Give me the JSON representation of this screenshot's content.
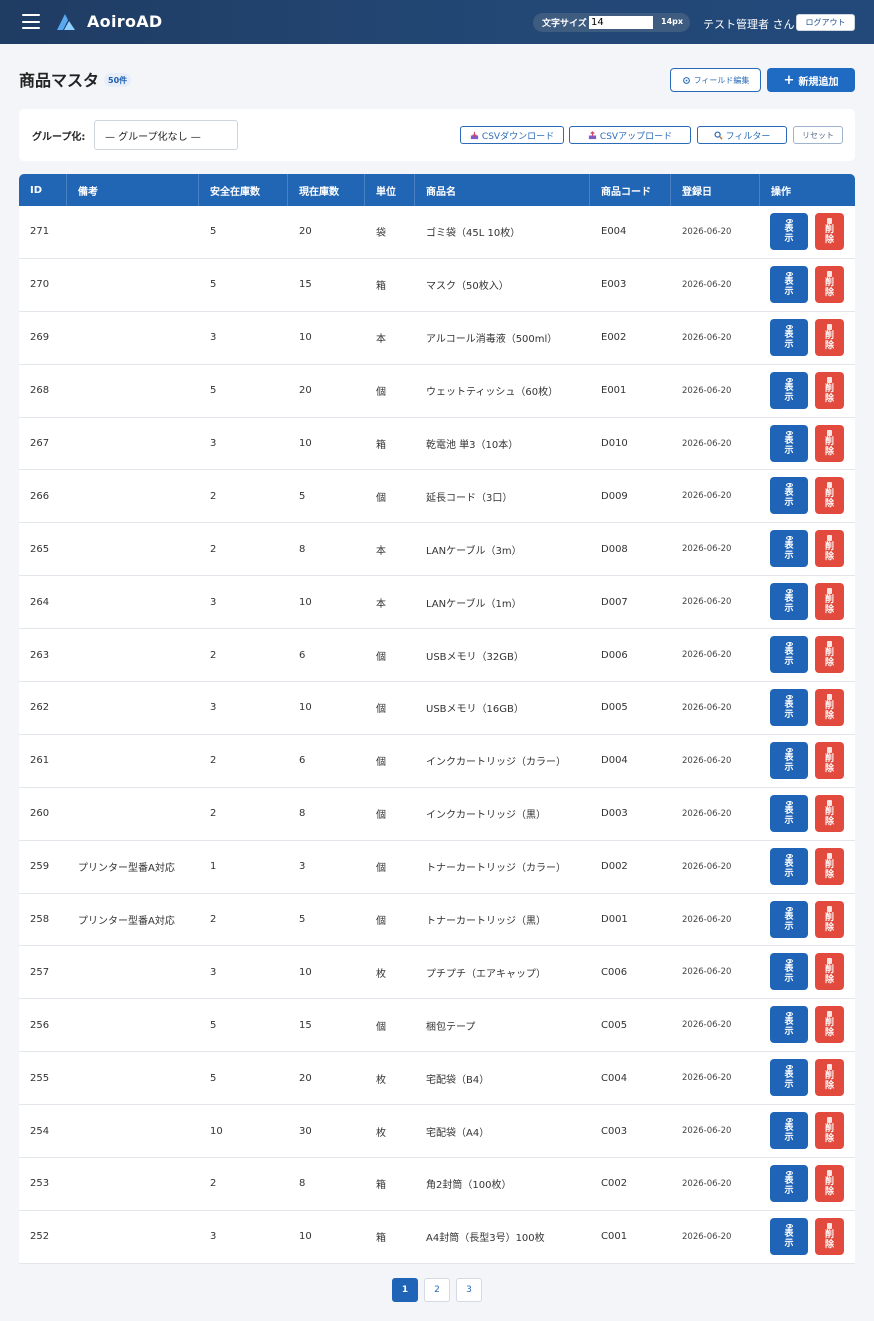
{
  "header": {
    "brand": "AoiroAD",
    "font_size_label": "文字サイズ",
    "font_size_value": "14",
    "font_size_unit": "14px",
    "user": "テスト管理者 さん",
    "logout": "ログアウト"
  },
  "page": {
    "title": "商品マスタ",
    "count": "50件",
    "field_edit": "フィールド編集",
    "add_new": "新規追加"
  },
  "toolbar": {
    "group_label": "グループ化:",
    "group_value": "— グループ化なし —",
    "csv_download": "CSVダウンロード",
    "csv_upload": "CSVアップロード",
    "filter": "フィルター",
    "reset": "リセット"
  },
  "table": {
    "columns": [
      "ID",
      "備考",
      "安全在庫数",
      "現在庫数",
      "単位",
      "商品名",
      "商品コード",
      "登録日",
      "操作"
    ],
    "view_label_1": "表",
    "view_label_2": "示",
    "delete_label_1": "削",
    "delete_label_2": "除",
    "rows": [
      {
        "id": "271",
        "note": "",
        "safety": "5",
        "stock": "20",
        "unit": "袋",
        "name": "ゴミ袋（45L 10枚）",
        "code": "E004",
        "date": "2026-06-20"
      },
      {
        "id": "270",
        "note": "",
        "safety": "5",
        "stock": "15",
        "unit": "箱",
        "name": "マスク（50枚入）",
        "code": "E003",
        "date": "2026-06-20"
      },
      {
        "id": "269",
        "note": "",
        "safety": "3",
        "stock": "10",
        "unit": "本",
        "name": "アルコール消毒液（500ml）",
        "code": "E002",
        "date": "2026-06-20"
      },
      {
        "id": "268",
        "note": "",
        "safety": "5",
        "stock": "20",
        "unit": "個",
        "name": "ウェットティッシュ（60枚）",
        "code": "E001",
        "date": "2026-06-20"
      },
      {
        "id": "267",
        "note": "",
        "safety": "3",
        "stock": "10",
        "unit": "箱",
        "name": "乾電池 単3（10本）",
        "code": "D010",
        "date": "2026-06-20"
      },
      {
        "id": "266",
        "note": "",
        "safety": "2",
        "stock": "5",
        "unit": "個",
        "name": "延長コード（3口）",
        "code": "D009",
        "date": "2026-06-20"
      },
      {
        "id": "265",
        "note": "",
        "safety": "2",
        "stock": "8",
        "unit": "本",
        "name": "LANケーブル（3m）",
        "code": "D008",
        "date": "2026-06-20"
      },
      {
        "id": "264",
        "note": "",
        "safety": "3",
        "stock": "10",
        "unit": "本",
        "name": "LANケーブル（1m）",
        "code": "D007",
        "date": "2026-06-20"
      },
      {
        "id": "263",
        "note": "",
        "safety": "2",
        "stock": "6",
        "unit": "個",
        "name": "USBメモリ（32GB）",
        "code": "D006",
        "date": "2026-06-20"
      },
      {
        "id": "262",
        "note": "",
        "safety": "3",
        "stock": "10",
        "unit": "個",
        "name": "USBメモリ（16GB）",
        "code": "D005",
        "date": "2026-06-20"
      },
      {
        "id": "261",
        "note": "",
        "safety": "2",
        "stock": "6",
        "unit": "個",
        "name": "インクカートリッジ（カラー）",
        "code": "D004",
        "date": "2026-06-20"
      },
      {
        "id": "260",
        "note": "",
        "safety": "2",
        "stock": "8",
        "unit": "個",
        "name": "インクカートリッジ（黒）",
        "code": "D003",
        "date": "2026-06-20"
      },
      {
        "id": "259",
        "note": "プリンター型番A対応",
        "safety": "1",
        "stock": "3",
        "unit": "個",
        "name": "トナーカートリッジ（カラー）",
        "code": "D002",
        "date": "2026-06-20"
      },
      {
        "id": "258",
        "note": "プリンター型番A対応",
        "safety": "2",
        "stock": "5",
        "unit": "個",
        "name": "トナーカートリッジ（黒）",
        "code": "D001",
        "date": "2026-06-20"
      },
      {
        "id": "257",
        "note": "",
        "safety": "3",
        "stock": "10",
        "unit": "枚",
        "name": "プチプチ（エアキャップ）",
        "code": "C006",
        "date": "2026-06-20"
      },
      {
        "id": "256",
        "note": "",
        "safety": "5",
        "stock": "15",
        "unit": "個",
        "name": "梱包テープ",
        "code": "C005",
        "date": "2026-06-20"
      },
      {
        "id": "255",
        "note": "",
        "safety": "5",
        "stock": "20",
        "unit": "枚",
        "name": "宅配袋（B4）",
        "code": "C004",
        "date": "2026-06-20"
      },
      {
        "id": "254",
        "note": "",
        "safety": "10",
        "stock": "30",
        "unit": "枚",
        "name": "宅配袋（A4）",
        "code": "C003",
        "date": "2026-06-20"
      },
      {
        "id": "253",
        "note": "",
        "safety": "2",
        "stock": "8",
        "unit": "箱",
        "name": "角2封筒（100枚）",
        "code": "C002",
        "date": "2026-06-20"
      },
      {
        "id": "252",
        "note": "",
        "safety": "3",
        "stock": "10",
        "unit": "箱",
        "name": "A4封筒（長型3号）100枚",
        "code": "C001",
        "date": "2026-06-20"
      }
    ]
  },
  "pagination": {
    "pages": [
      "1",
      "2",
      "3"
    ],
    "current": "1"
  },
  "colors": {
    "header_bg": "#1f3c63",
    "accent": "#2166b5",
    "delete": "#e14a3c"
  }
}
